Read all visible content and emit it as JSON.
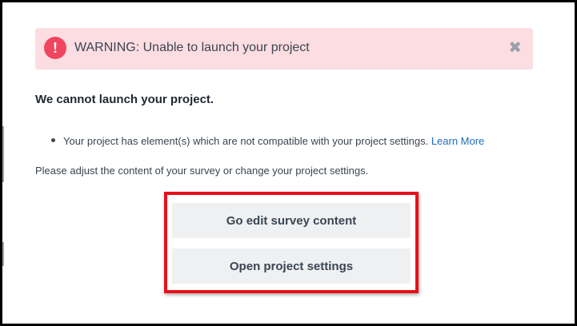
{
  "alert": {
    "icon": "!",
    "icon_name": "exclamation-circle-icon",
    "message": "WARNING: Unable to launch your project",
    "close_glyph": "✖",
    "close_icon_name": "close-icon",
    "background_color": "#fcdde1",
    "icon_color": "#f0455e"
  },
  "heading": "We cannot launch your project.",
  "issues": [
    {
      "text": "Your project has element(s) which are not compatible with your project settings.",
      "link_label": "Learn More"
    }
  ],
  "instruction": "Please adjust the content of your survey or change your project settings.",
  "actions": {
    "edit_content_label": "Go edit survey content",
    "project_settings_label": "Open project settings",
    "highlight_color": "#e8101b"
  },
  "colors": {
    "link": "#1c6bbd",
    "button_background": "#eef0f2"
  }
}
